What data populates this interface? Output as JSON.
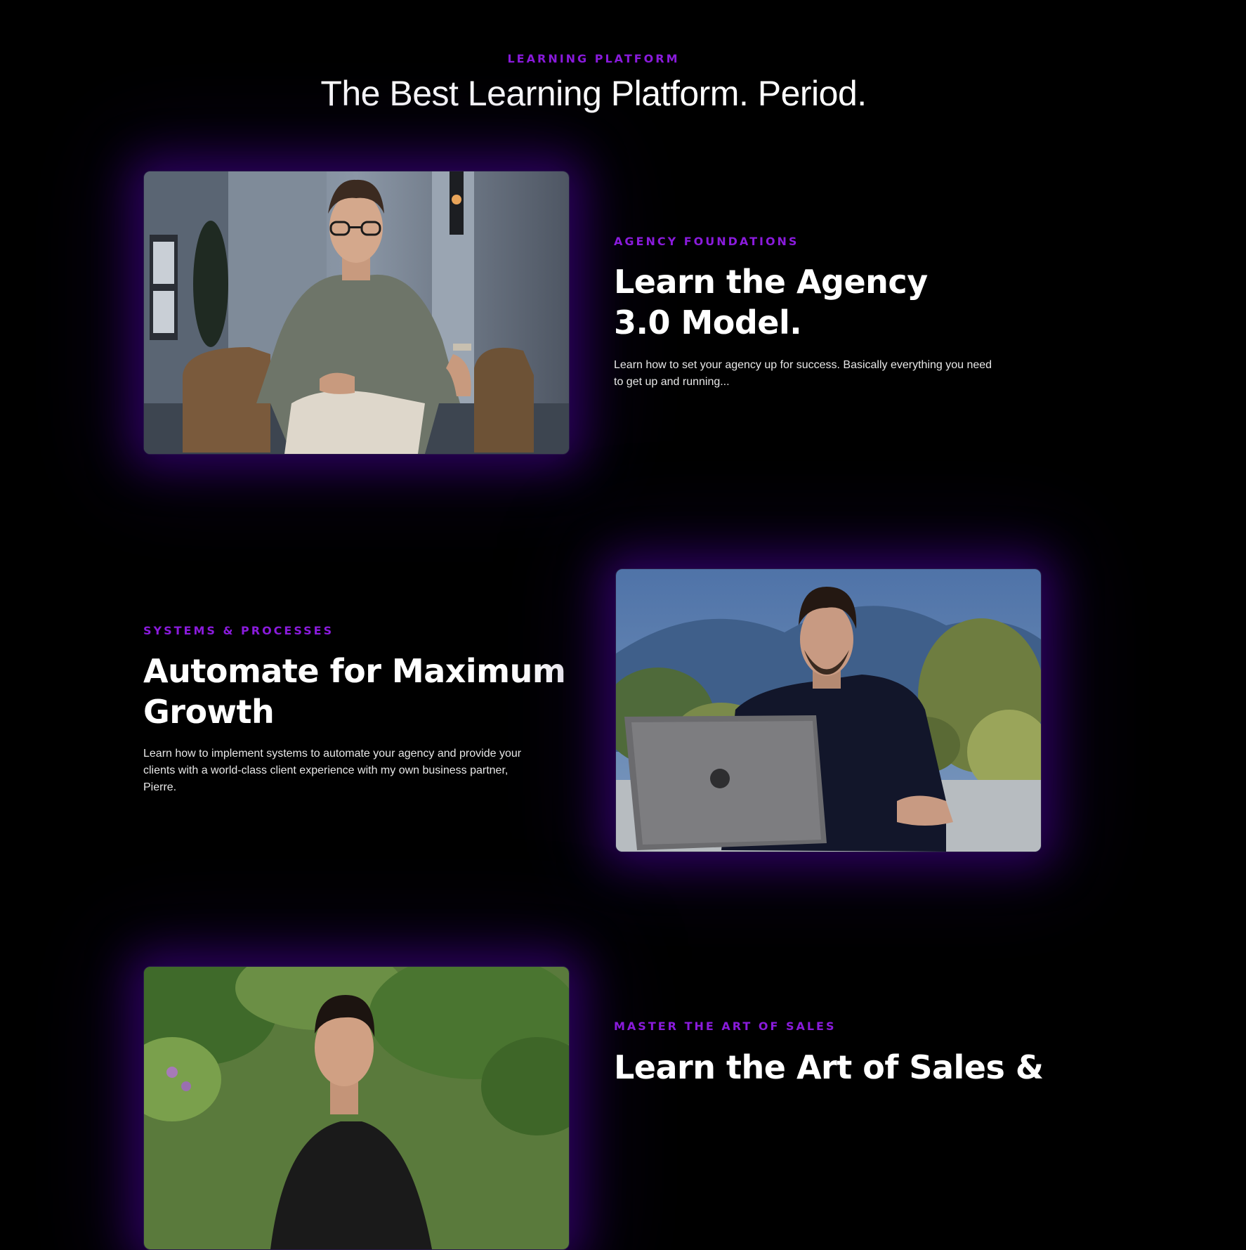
{
  "header": {
    "eyebrow": "LEARNING PLATFORM",
    "title": "The Best Learning Platform. Period."
  },
  "sections": [
    {
      "eyebrow": "AGENCY FOUNDATIONS",
      "title_line1": "Learn the Agency",
      "title_line2": "3.0 Model.",
      "description_line1": "Learn how to set your agency up for success. Basically everything you need",
      "description_line2": "to get up and running...",
      "image": "man-in-chair-photo"
    },
    {
      "eyebrow": "SYSTEMS & PROCESSES",
      "title_line1": "Automate for Maximum",
      "title_line2": "Growth",
      "description_line1": "Learn how to implement systems to automate your agency and provide your",
      "description_line2": "clients with a world-class client experience with my own business partner,",
      "description_line3": "Pierre.",
      "image": "man-with-laptop-photo"
    },
    {
      "eyebrow": "MASTER THE ART OF SALES",
      "title_line1": "Learn the Art of Sales &",
      "image": "man-outdoors-photo"
    }
  ],
  "colors": {
    "background": "#000000",
    "accent": "#8a1bdc",
    "glow": "#46009a",
    "text": "#ffffff"
  }
}
